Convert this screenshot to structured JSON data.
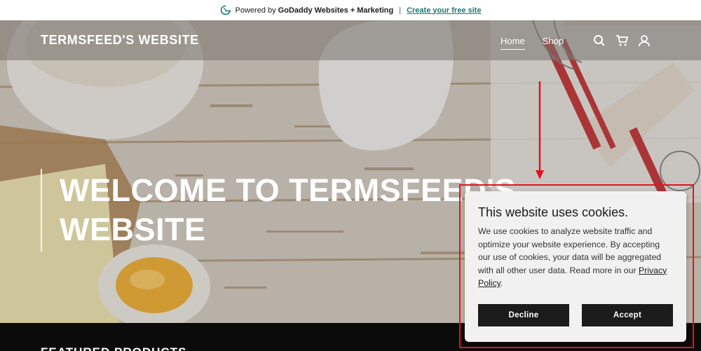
{
  "promo": {
    "prefix": "Powered by",
    "brand": "GoDaddy Websites + Marketing",
    "separator": "|",
    "link": "Create your free site"
  },
  "header": {
    "logo": "TERMSFEED'S WEBSITE",
    "nav": [
      {
        "label": "Home",
        "active": true
      },
      {
        "label": "Shop",
        "active": false
      }
    ],
    "icons": [
      "search-icon",
      "cart-icon",
      "user-icon"
    ]
  },
  "hero": {
    "title_line1": "WELCOME TO TERMSFEED'S",
    "title_line2": "WEBSITE"
  },
  "section": {
    "featured": "FEATURED PRODUCTS"
  },
  "cookie": {
    "title": "This website uses cookies.",
    "body": "We use cookies to analyze website traffic and optimize your website experience. By accepting our use of cookies, your data will be aggregated with all other user data. Read more in our",
    "policy_link": "Privacy Policy",
    "body_end": ".",
    "decline": "Decline",
    "accept": "Accept"
  },
  "colors": {
    "annotation": "#e0141e",
    "dialog_bg": "#f2f1f1",
    "button_bg": "#1b1b1b",
    "promo_link": "#1a7a74"
  }
}
